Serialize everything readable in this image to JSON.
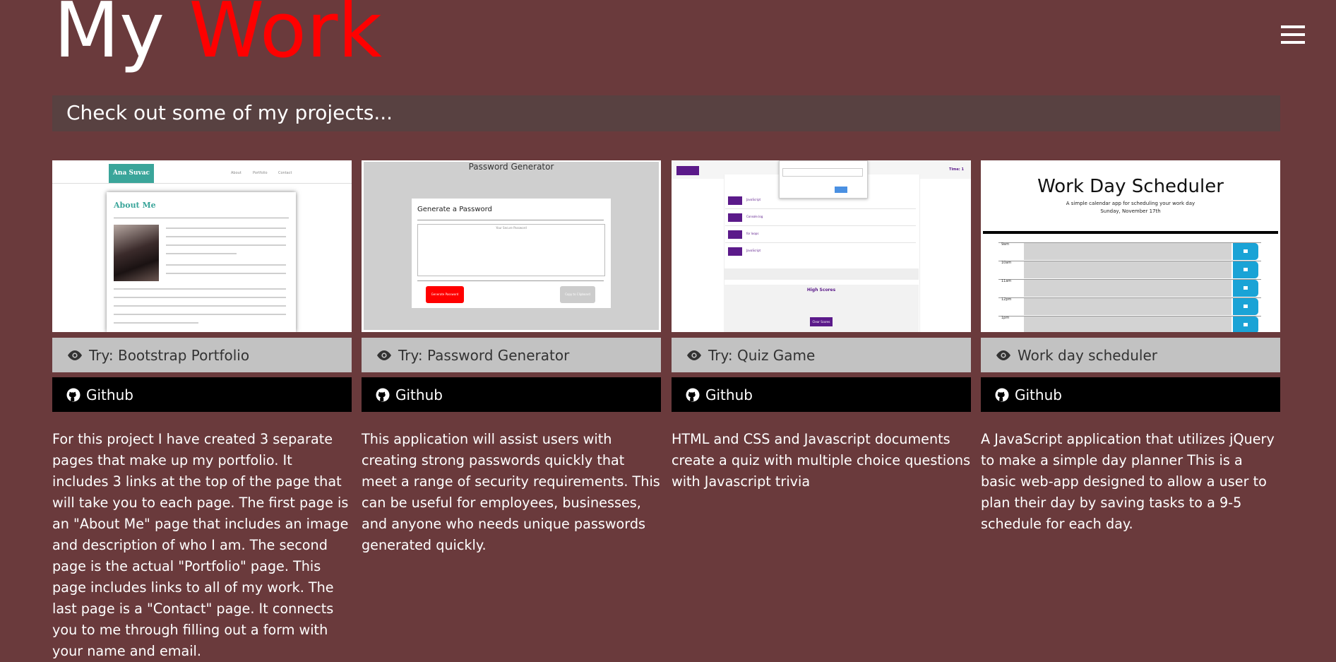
{
  "header": {
    "title_word1": "My",
    "title_word2": "Work",
    "accent_color": "#ff0000",
    "menu_icon": "hamburger-menu-icon"
  },
  "subtitle": "Check out some of my projects...",
  "projects": [
    {
      "try_label": "Try: Bootstrap Portfolio",
      "github_label": "Github",
      "description": "For this project I have created 3 separate pages that make up my portfolio. It includes 3 links at the top of the page that will take you to each page. The first page is an \"About Me\" page that includes an image and description of who I am. The second page is the actual \"Portfolio\" page. This page includes links to all of my work. The last page is a \"Contact\" page. It connects you to me through filling out a form with your name and email.",
      "thumb": {
        "brand": "Ana Suvac",
        "nav": [
          "About",
          "Portfolio",
          "Contact"
        ],
        "heading": "About Me"
      }
    },
    {
      "try_label": "Try: Password Generator",
      "github_label": "Github",
      "description": "This application will assist users with creating strong passwords quickly that meet a range of security requirements. This can be useful for employees, businesses, and anyone who needs unique passwords generated quickly.",
      "thumb": {
        "title": "Password Generator",
        "card_title": "Generate a Password",
        "placeholder": "Your Secure Password",
        "generate_button": "Generate Password",
        "copy_button": "Copy to Clipboard"
      }
    },
    {
      "try_label": "Try: Quiz Game",
      "github_label": "Github",
      "description": "HTML and CSS and Javascript documents create a quiz with multiple choice questions with Javascript trivia",
      "thumb": {
        "time": "Time: 1",
        "options": [
          {
            "num": "1",
            "label": "JavaScript"
          },
          {
            "num": "2",
            "label": "Console.log"
          },
          {
            "num": "3",
            "label": "for loops"
          },
          {
            "num": "4",
            "label": "JavaScript"
          }
        ],
        "high_scores": "High Scores",
        "clear_button": "Clear Scores"
      }
    },
    {
      "try_label": "Work day scheduler",
      "github_label": "Github",
      "description": "A JavaScript application that utilizes jQuery to make a simple day planner This is a basic web-app designed to allow a user to plan their day by saving tasks to a 9-5 schedule for each day.",
      "thumb": {
        "title": "Work Day Scheduler",
        "subtitle": "A simple calendar app for scheduling your work day",
        "date": "Sunday, November 17th",
        "hours": [
          "9am",
          "10am",
          "11am",
          "12pm",
          "1pm"
        ]
      }
    }
  ],
  "colors": {
    "page_background": "#6a3a3c",
    "subtitle_bar": "#584141",
    "try_button": "#c2c2c2",
    "github_button": "#000000"
  }
}
